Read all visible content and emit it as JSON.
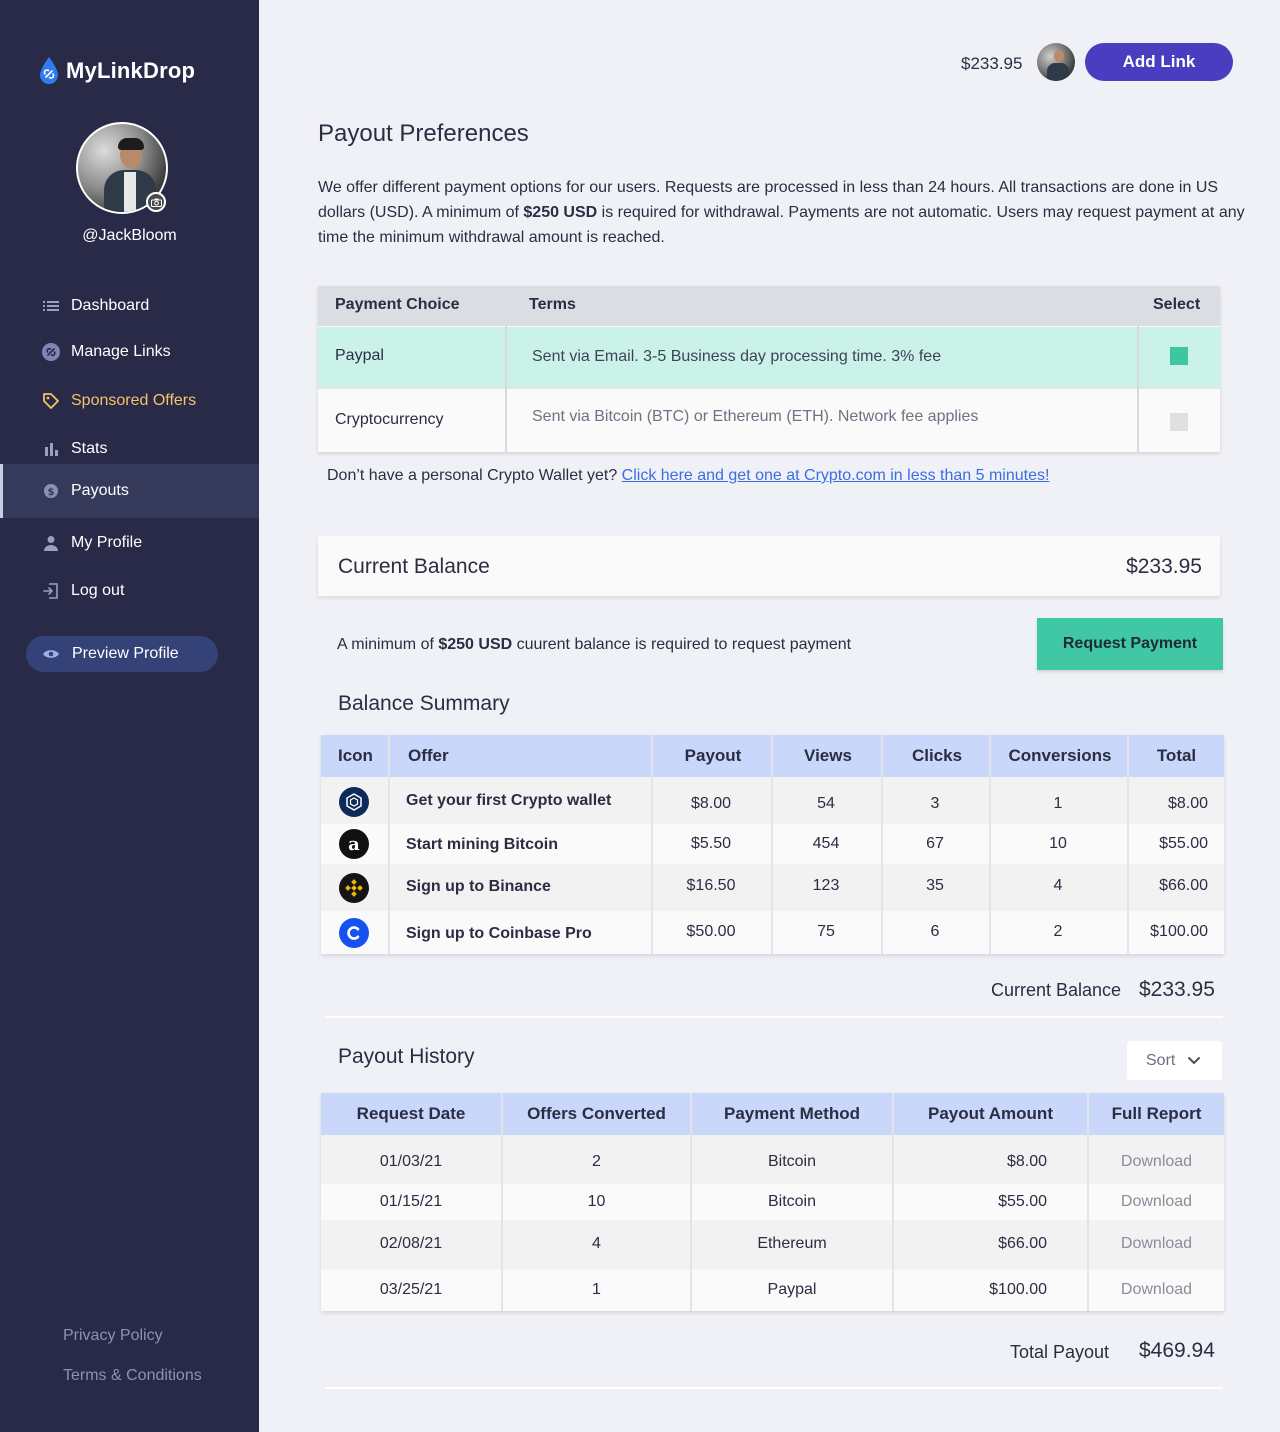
{
  "sidebar": {
    "logo_text": "MyLinkDrop",
    "username": "@JackBloom",
    "nav": [
      {
        "label": "Dashboard",
        "icon": "list-icon"
      },
      {
        "label": "Manage Links",
        "icon": "link-icon"
      },
      {
        "label": "Sponsored Offers",
        "icon": "tag-icon"
      },
      {
        "label": "Stats",
        "icon": "bar-chart-icon"
      },
      {
        "label": "Payouts",
        "icon": "dollar-icon"
      },
      {
        "label": "My Profile",
        "icon": "person-icon"
      },
      {
        "label": "Log out",
        "icon": "logout-icon"
      }
    ],
    "active_item": "Payouts",
    "highlight_item": "Sponsored Offers",
    "preview_label": "Preview Profile",
    "footer": {
      "privacy": "Privacy Policy",
      "terms": "Terms & Conditions"
    }
  },
  "header": {
    "balance": "$233.95",
    "add_link_label": "Add Link"
  },
  "page": {
    "title": "Payout Preferences",
    "intro_1": "We offer different payment options for our users.  Requests are processed in less than 24 hours. All transactions are done in US dollars (USD).  A minimum of ",
    "intro_bold": "$250 USD",
    "intro_2": " is required for withdrawal. Payments are not automatic. Users may request payment at any time the minimum withdrawal amount is reached."
  },
  "payment_table": {
    "headers": {
      "choice": "Payment Choice",
      "terms": "Terms",
      "select": "Select"
    },
    "rows": [
      {
        "choice": "Paypal",
        "terms": "Sent via Email. 3-5 Business day processing time. 3% fee",
        "selected": true
      },
      {
        "choice": "Cryptocurrency",
        "terms": "Sent via Bitcoin (BTC) or Ethereum (ETH). Network fee applies",
        "selected": false
      }
    ]
  },
  "crypto_prompt": {
    "text": "Don’t have a personal Crypto Wallet yet? ",
    "link": "Click here and get one at Crypto.com in less than 5 minutes!"
  },
  "current_balance": {
    "label": "Current Balance",
    "value": "$233.95",
    "note_1": "A minimum of ",
    "note_bold": "$250 USD",
    "note_2": " cuurent balance is required to request payment",
    "request_label": "Request Payment"
  },
  "balance_summary": {
    "title": "Balance Summary",
    "headers": [
      "Icon",
      "Offer",
      "Payout",
      "Views",
      "Clicks",
      "Conversions",
      "Total"
    ],
    "rows": [
      {
        "icon": "crypto-com-icon",
        "offer": "Get your first Crypto wallet",
        "payout": "$8.00",
        "views": "54",
        "clicks": "3",
        "conversions": "1",
        "total": "$8.00"
      },
      {
        "icon": "amazon-icon",
        "offer": "Start mining Bitcoin",
        "payout": "$5.50",
        "views": "454",
        "clicks": "67",
        "conversions": "10",
        "total": "$55.00"
      },
      {
        "icon": "binance-icon",
        "offer": "Sign up to Binance",
        "payout": "$16.50",
        "views": "123",
        "clicks": "35",
        "conversions": "4",
        "total": "$66.00"
      },
      {
        "icon": "coinbase-icon",
        "offer": "Sign up to Coinbase Pro",
        "payout": "$50.00",
        "views": "75",
        "clicks": "6",
        "conversions": "2",
        "total": "$100.00"
      }
    ],
    "footer_label": "Current Balance",
    "footer_value": "$233.95"
  },
  "payout_history": {
    "title": "Payout History",
    "sort_label": "Sort",
    "headers": [
      "Request Date",
      "Offers Converted",
      "Payment Method",
      "Payout Amount",
      "Full Report"
    ],
    "rows": [
      {
        "date": "01/03/21",
        "offers": "2",
        "method": "Bitcoin",
        "amount": "$8.00",
        "report": "Download"
      },
      {
        "date": "01/15/21",
        "offers": "10",
        "method": "Bitcoin",
        "amount": "$55.00",
        "report": "Download"
      },
      {
        "date": "02/08/21",
        "offers": "4",
        "method": "Ethereum",
        "amount": "$66.00",
        "report": "Download"
      },
      {
        "date": "03/25/21",
        "offers": "1",
        "method": "Paypal",
        "amount": "$100.00",
        "report": "Download"
      }
    ],
    "total_label": "Total Payout",
    "total_value": "$469.94"
  },
  "colors": {
    "sidebar_bg": "#282a48",
    "accent_purple": "#4a3dbf",
    "accent_green": "#40c8a4",
    "selected_row": "#cbf2e8",
    "table_header": "#c9d7fb",
    "link_blue": "#3a6ee0",
    "highlight_nav": "#f5c26b"
  }
}
